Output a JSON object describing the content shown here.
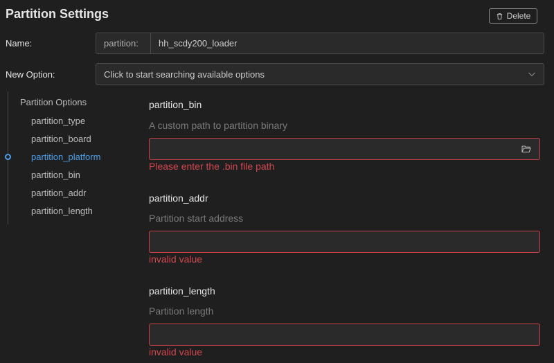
{
  "header": {
    "title": "Partition Settings",
    "delete_label": "Delete"
  },
  "name_row": {
    "label": "Name:",
    "prefix": "partition:",
    "value": "hh_scdy200_loader"
  },
  "option_row": {
    "label": "New Option:",
    "placeholder": "Click to start searching available options"
  },
  "sidebar": {
    "heading": "Partition Options",
    "items": [
      {
        "label": "partition_type"
      },
      {
        "label": "partition_board"
      },
      {
        "label": "partition_platform"
      },
      {
        "label": "partition_bin"
      },
      {
        "label": "partition_addr"
      },
      {
        "label": "partition_length"
      }
    ],
    "active_index": 2
  },
  "fields": [
    {
      "title": "partition_bin",
      "description": "A custom path to partition binary",
      "value": "",
      "error": "Please enter the .bin file path",
      "icon": "folder-open-icon"
    },
    {
      "title": "partition_addr",
      "description": "Partition start address",
      "value": "",
      "error": "invalid value"
    },
    {
      "title": "partition_length",
      "description": "Partition length",
      "value": "",
      "error": "invalid value"
    }
  ],
  "colors": {
    "background": "#1f1f1f",
    "accent": "#4f9fe8",
    "error": "#d0474f"
  }
}
